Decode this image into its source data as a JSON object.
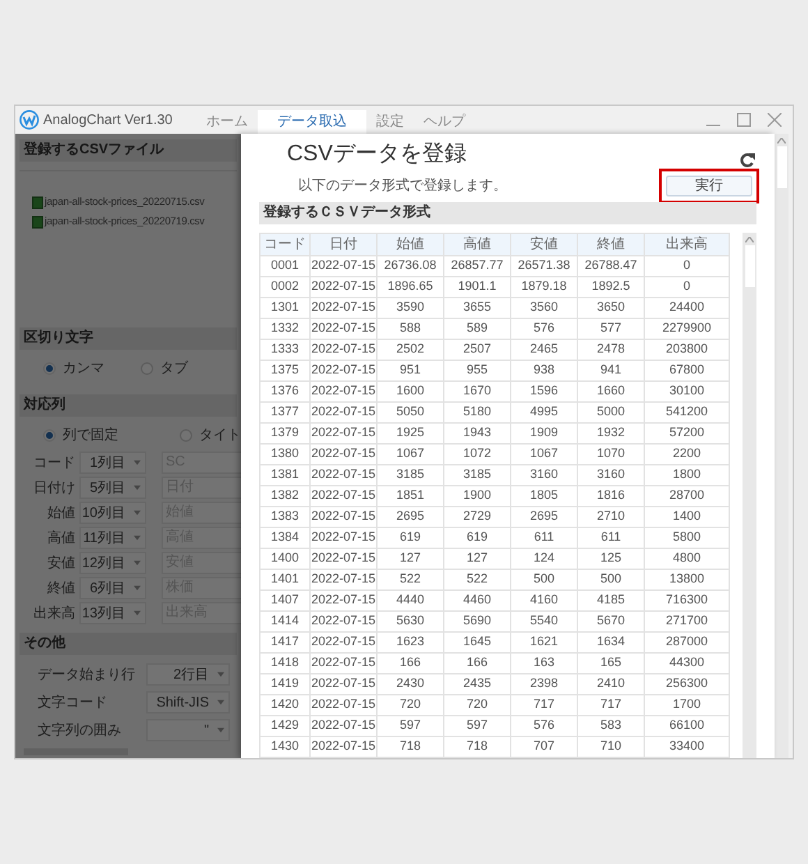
{
  "window": {
    "title": "AnalogChart Ver1.30",
    "tabs": [
      {
        "label": "ホーム",
        "selected": false
      },
      {
        "label": "データ取込",
        "selected": true
      },
      {
        "label": "設定",
        "selected": false
      },
      {
        "label": "ヘルプ",
        "selected": false
      }
    ]
  },
  "left_panel": {
    "dimmed": true,
    "csv_files": {
      "heading": "登録するCSVファイル",
      "files": [
        "japan-all-stock-prices_20220715.csv",
        "japan-all-stock-prices_20220719.csv"
      ]
    },
    "delimiter": {
      "heading": "区切り文字",
      "options": [
        {
          "label": "カンマ",
          "selected": true
        },
        {
          "label": "タブ",
          "selected": false
        }
      ]
    },
    "columns": {
      "heading": "対応列",
      "modes": [
        {
          "label": "列で固定",
          "selected": true
        },
        {
          "label": "タイト",
          "selected": false
        }
      ],
      "mappings": [
        {
          "label": "コード",
          "column": "1列目",
          "header": "SC"
        },
        {
          "label": "日付け",
          "column": "5列目",
          "header": "日付"
        },
        {
          "label": "始値",
          "column": "10列目",
          "header": "始値"
        },
        {
          "label": "高値",
          "column": "11列目",
          "header": "高値"
        },
        {
          "label": "安値",
          "column": "12列目",
          "header": "安値"
        },
        {
          "label": "終値",
          "column": "6列目",
          "header": "株価"
        },
        {
          "label": "出来高",
          "column": "13列目",
          "header": "出来高"
        }
      ]
    },
    "other": {
      "heading": "その他",
      "settings": [
        {
          "label": "データ始まり行",
          "value": "2行目"
        },
        {
          "label": "文字コード",
          "value": "Shift-JIS"
        },
        {
          "label": "文字列の囲み",
          "value": "\""
        }
      ]
    }
  },
  "dialog": {
    "title": "CSVデータを登録",
    "subtitle": "以下のデータ形式で登録します。",
    "execute_button": {
      "label": "実行",
      "highlighted": true
    },
    "table": {
      "heading": "登録するＣＳＶデータ形式",
      "columns": [
        "コード",
        "日付",
        "始値",
        "高値",
        "安値",
        "終値",
        "出来高"
      ],
      "rows": [
        [
          "0001",
          "2022-07-15",
          "26736.08",
          "26857.77",
          "26571.38",
          "26788.47",
          "0"
        ],
        [
          "0002",
          "2022-07-15",
          "1896.65",
          "1901.1",
          "1879.18",
          "1892.5",
          "0"
        ],
        [
          "1301",
          "2022-07-15",
          "3590",
          "3655",
          "3560",
          "3650",
          "24400"
        ],
        [
          "1332",
          "2022-07-15",
          "588",
          "589",
          "576",
          "577",
          "2279900"
        ],
        [
          "1333",
          "2022-07-15",
          "2502",
          "2507",
          "2465",
          "2478",
          "203800"
        ],
        [
          "1375",
          "2022-07-15",
          "951",
          "955",
          "938",
          "941",
          "67800"
        ],
        [
          "1376",
          "2022-07-15",
          "1600",
          "1670",
          "1596",
          "1660",
          "30100"
        ],
        [
          "1377",
          "2022-07-15",
          "5050",
          "5180",
          "4995",
          "5000",
          "541200"
        ],
        [
          "1379",
          "2022-07-15",
          "1925",
          "1943",
          "1909",
          "1932",
          "57200"
        ],
        [
          "1380",
          "2022-07-15",
          "1067",
          "1072",
          "1067",
          "1070",
          "2200"
        ],
        [
          "1381",
          "2022-07-15",
          "3185",
          "3185",
          "3160",
          "3160",
          "1800"
        ],
        [
          "1382",
          "2022-07-15",
          "1851",
          "1900",
          "1805",
          "1816",
          "28700"
        ],
        [
          "1383",
          "2022-07-15",
          "2695",
          "2729",
          "2695",
          "2710",
          "1400"
        ],
        [
          "1384",
          "2022-07-15",
          "619",
          "619",
          "611",
          "611",
          "5800"
        ],
        [
          "1400",
          "2022-07-15",
          "127",
          "127",
          "124",
          "125",
          "4800"
        ],
        [
          "1401",
          "2022-07-15",
          "522",
          "522",
          "500",
          "500",
          "13800"
        ],
        [
          "1407",
          "2022-07-15",
          "4440",
          "4460",
          "4160",
          "4185",
          "716300"
        ],
        [
          "1414",
          "2022-07-15",
          "5630",
          "5690",
          "5540",
          "5670",
          "271700"
        ],
        [
          "1417",
          "2022-07-15",
          "1623",
          "1645",
          "1621",
          "1634",
          "287000"
        ],
        [
          "1418",
          "2022-07-15",
          "166",
          "166",
          "163",
          "165",
          "44300"
        ],
        [
          "1419",
          "2022-07-15",
          "2430",
          "2435",
          "2398",
          "2410",
          "256300"
        ],
        [
          "1420",
          "2022-07-15",
          "720",
          "720",
          "717",
          "717",
          "1700"
        ],
        [
          "1429",
          "2022-07-15",
          "597",
          "597",
          "576",
          "583",
          "66100"
        ],
        [
          "1430",
          "2022-07-15",
          "718",
          "718",
          "707",
          "710",
          "33400"
        ]
      ]
    }
  }
}
